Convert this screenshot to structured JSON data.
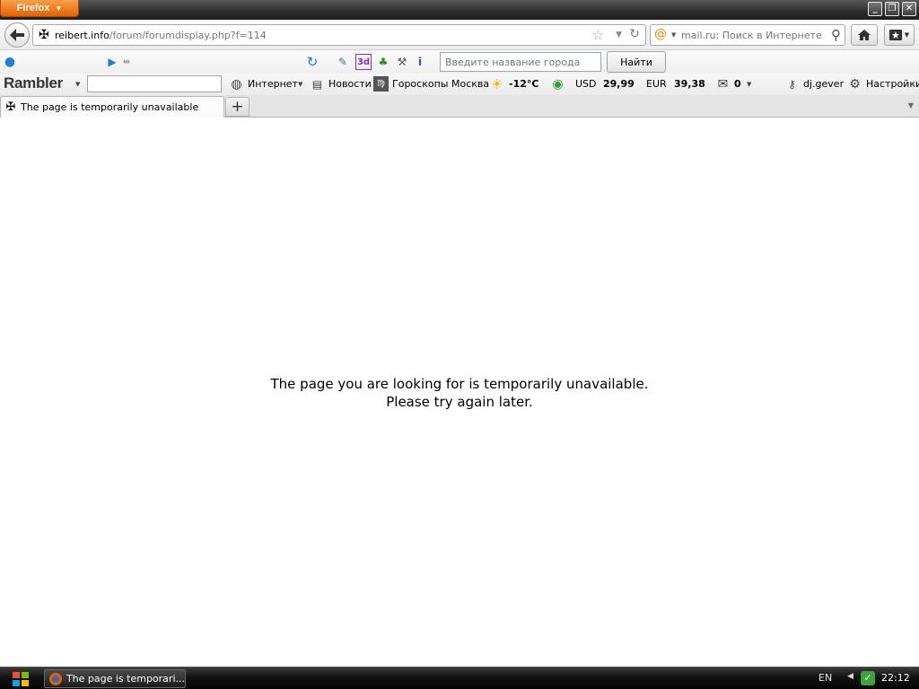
{
  "window": {
    "app_button": "Firefox",
    "minimize": "_",
    "restore": "❐",
    "close": "✕"
  },
  "nav": {
    "url_domain": "reibert.info",
    "url_path": "/forum/forumdisplay.php?f=114",
    "search_placeholder": "mail.ru: Поиск в Интернете"
  },
  "toolbar2": {
    "city_placeholder": "Введите название города",
    "find_label": "Найти"
  },
  "rambler": {
    "logo": "Rambler",
    "internet": "Интернет",
    "news": "Новости",
    "horoscopes": "Гороскопы",
    "city": "Москва",
    "temperature": "-12°C",
    "usd_label": "USD",
    "usd_value": "29,99",
    "eur_label": "EUR",
    "eur_value": "39,38",
    "mail_count": "0",
    "username": "dj.gever",
    "settings": "Настройки"
  },
  "tabs": [
    {
      "label": "The page is temporarily unavailable"
    }
  ],
  "new_tab": "+",
  "content": {
    "line1": "The page you are looking for is temporarily unavailable.",
    "line2": "Please try again later."
  },
  "taskbar": {
    "task_label": "The page is temporari...",
    "language": "EN",
    "clock": "22:12"
  },
  "colors": {
    "firefox_orange": "#e66000",
    "accent_blue": "#1f7fd0"
  }
}
